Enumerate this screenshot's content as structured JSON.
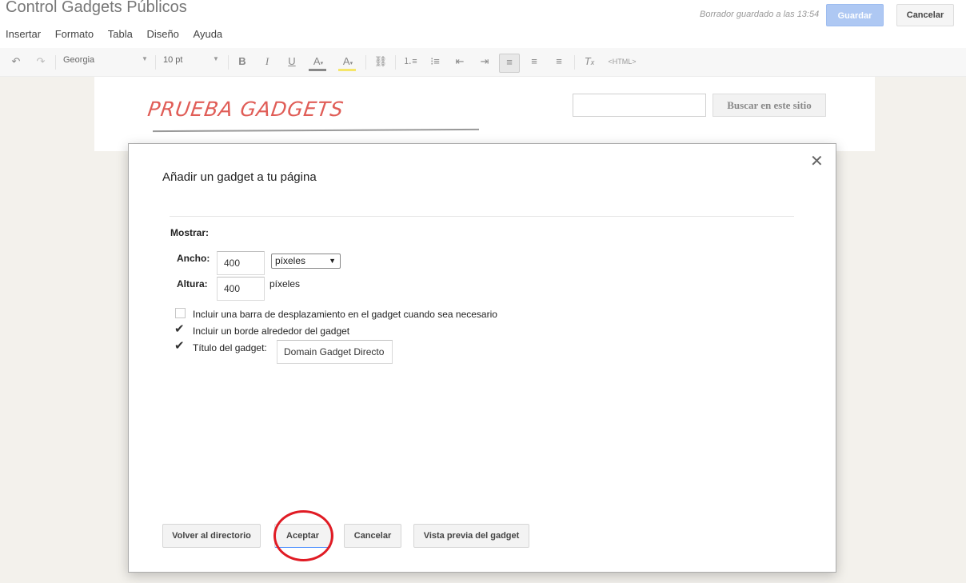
{
  "header": {
    "title": "Control Gadgets Públicos",
    "draft_status": "Borrador guardado a las 13:54",
    "save_label": "Guardar",
    "cancel_label": "Cancelar"
  },
  "menu": {
    "items": [
      "Insertar",
      "Formato",
      "Tabla",
      "Diseño",
      "Ayuda"
    ]
  },
  "toolbar": {
    "font": "Georgia",
    "size": "10 pt",
    "html_label": "<HTML>"
  },
  "page": {
    "site_title": "PRUEBA GADGETS",
    "search_button": "Buscar en este sitio"
  },
  "dialog": {
    "title": "Añadir un gadget a tu página",
    "show_label": "Mostrar:",
    "width_label": "Ancho:",
    "width_value": "400",
    "width_unit": "píxeles",
    "height_label": "Altura:",
    "height_value": "400",
    "height_unit": "píxeles",
    "scrollbar_label": "Incluir una barra de desplazamiento en el gadget cuando sea necesario",
    "scrollbar_checked": false,
    "border_label": "Incluir un borde alrededor del gadget",
    "border_checked": true,
    "title_label": "Título del gadget:",
    "title_checked": true,
    "title_value": "Domain Gadget Directo",
    "buttons": {
      "back": "Volver al directorio",
      "accept": "Aceptar",
      "cancel": "Cancelar",
      "preview": "Vista previa del gadget"
    }
  }
}
